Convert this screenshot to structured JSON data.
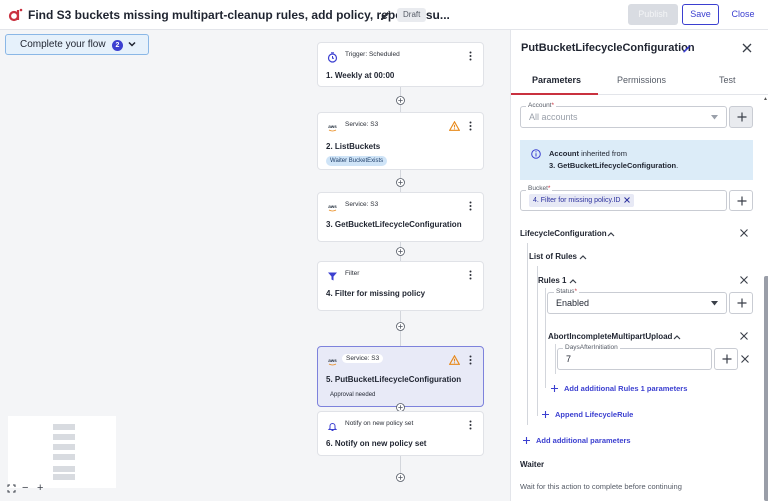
{
  "header": {
    "title": "Find S3 buckets missing multipart-cleanup rules, add policy, report resu...",
    "status_badge": "Draft",
    "publish_label": "Publish",
    "save_label": "Save",
    "close_label": "Close"
  },
  "canvas": {
    "complete_flow_label": "Complete your flow",
    "complete_flow_count": "2",
    "nodes": [
      {
        "service": "Trigger: Scheduled",
        "name": "1. Weekly at 00:00",
        "icon": "clock-icon"
      },
      {
        "service": "Service: S3",
        "name": "2. ListBuckets",
        "chip": "Waiter BucketExists",
        "warning": true,
        "icon": "aws-icon"
      },
      {
        "service": "Service: S3",
        "name": "3. GetBucketLifecycleConfiguration",
        "icon": "aws-icon"
      },
      {
        "service": "Filter",
        "name": "4. Filter for missing policy",
        "icon": "filter-icon"
      },
      {
        "service": "Service: S3",
        "name": "5. PutBucketLifecycleConfiguration",
        "chip": "Approval needed",
        "warning": true,
        "selected": true,
        "icon": "aws-icon"
      },
      {
        "service": "Notify on new policy set",
        "name": "6. Notify on new policy set",
        "icon": "bell-icon"
      }
    ],
    "zoom_controls": [
      "fit",
      "−",
      "+"
    ]
  },
  "panel": {
    "title": "PutBucketLifecycleConfiguration",
    "tabs": [
      "Parameters",
      "Permissions",
      "Test"
    ],
    "active_tab": "Parameters",
    "account": {
      "label": "Account",
      "placeholder": "All accounts"
    },
    "info": {
      "line1_bold": "Account",
      "line1_rest": " inherited from",
      "line2_bold": "3. GetBucketLifecycleConfiguration",
      "line2_rest": "."
    },
    "bucket": {
      "label": "Bucket",
      "tag": "4. Filter for missing policy.ID"
    },
    "lifecycle_label": "LifecycleConfiguration",
    "list_rules_label": "List of Rules",
    "rules1_label": "Rules 1",
    "status": {
      "label": "Status",
      "value": "Enabled"
    },
    "abort_label": "AbortIncompleteMultipartUpload",
    "days": {
      "label": "DaysAfterInitiation",
      "value": "7"
    },
    "add_rules_params": "Add additional Rules 1 parameters",
    "append_rule": "Append LifecycleRule",
    "add_params": "Add additional parameters",
    "waiter_label": "Waiter",
    "waiter_desc": "Wait for this action to complete before continuing"
  },
  "colors": {
    "accent": "#3b3fd0",
    "brand": "#c9313f",
    "warning": "#e8891a",
    "info_bg": "#dcecf8"
  }
}
